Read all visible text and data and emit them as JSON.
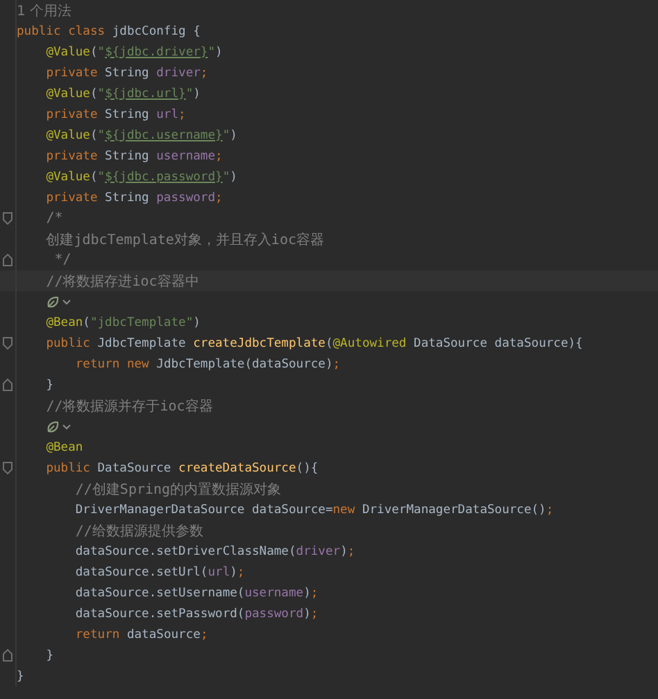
{
  "editor": {
    "lines": [
      {
        "kind": "usage_hint",
        "text": "1 个用法",
        "current": false
      },
      {
        "kind": "code",
        "current": false,
        "tokens": [
          {
            "text": "public",
            "kind": "keyword"
          },
          {
            "text": " class",
            "kind": "keyword"
          },
          {
            "text": " jdbcConfig {",
            "kind": "plain"
          }
        ],
        "children": [
          {
            "kind": "code",
            "current": false,
            "tokens": [
              {
                "text": "@Value",
                "kind": "annotation"
              },
              {
                "text": "(",
                "kind": "plain"
              },
              {
                "text": "\"",
                "kind": "string"
              },
              {
                "text": "${jdbc.driver}",
                "kind": "string_ref"
              },
              {
                "text": "\"",
                "kind": "string"
              },
              {
                "text": ")",
                "kind": "plain"
              }
            ]
          },
          {
            "kind": "code",
            "current": false,
            "tokens": [
              {
                "text": "private",
                "kind": "keyword"
              },
              {
                "text": " String ",
                "kind": "plain"
              },
              {
                "text": "driver",
                "kind": "field"
              },
              {
                "text": ";",
                "kind": "punct"
              }
            ]
          },
          {
            "kind": "code",
            "current": false,
            "tokens": [
              {
                "text": "@Value",
                "kind": "annotation"
              },
              {
                "text": "(",
                "kind": "plain"
              },
              {
                "text": "\"",
                "kind": "string"
              },
              {
                "text": "${jdbc.url}",
                "kind": "string_ref"
              },
              {
                "text": "\"",
                "kind": "string"
              },
              {
                "text": ")",
                "kind": "plain"
              }
            ]
          },
          {
            "kind": "code",
            "current": false,
            "tokens": [
              {
                "text": "private",
                "kind": "keyword"
              },
              {
                "text": " String ",
                "kind": "plain"
              },
              {
                "text": "url",
                "kind": "field"
              },
              {
                "text": ";",
                "kind": "punct"
              }
            ]
          },
          {
            "kind": "code",
            "current": false,
            "tokens": [
              {
                "text": "@Value",
                "kind": "annotation"
              },
              {
                "text": "(",
                "kind": "plain"
              },
              {
                "text": "\"",
                "kind": "string"
              },
              {
                "text": "${jdbc.username}",
                "kind": "string_ref"
              },
              {
                "text": "\"",
                "kind": "string"
              },
              {
                "text": ")",
                "kind": "plain"
              }
            ]
          },
          {
            "kind": "code",
            "current": false,
            "tokens": [
              {
                "text": "private",
                "kind": "keyword"
              },
              {
                "text": " String ",
                "kind": "plain"
              },
              {
                "text": "username",
                "kind": "field"
              },
              {
                "text": ";",
                "kind": "punct"
              }
            ]
          },
          {
            "kind": "code",
            "current": false,
            "tokens": [
              {
                "text": "@Value",
                "kind": "annotation"
              },
              {
                "text": "(",
                "kind": "plain"
              },
              {
                "text": "\"",
                "kind": "string"
              },
              {
                "text": "${jdbc.password}",
                "kind": "string_ref"
              },
              {
                "text": "\"",
                "kind": "string"
              },
              {
                "text": ")",
                "kind": "plain"
              }
            ]
          },
          {
            "kind": "code",
            "current": false,
            "tokens": [
              {
                "text": "private",
                "kind": "keyword"
              },
              {
                "text": " String ",
                "kind": "plain"
              },
              {
                "text": "password",
                "kind": "field"
              },
              {
                "text": ";",
                "kind": "punct"
              }
            ]
          },
          {
            "kind": "code",
            "current": false,
            "marker": {
              "kind": "fold_start"
            },
            "tokens": [
              {
                "text": "/*",
                "kind": "comment"
              }
            ]
          },
          {
            "kind": "code",
            "current": false,
            "tokens": [
              {
                "text": "创建jdbcTemplate对象，并且存入ioc容器",
                "kind": "comment"
              }
            ]
          },
          {
            "kind": "code",
            "current": false,
            "marker": {
              "kind": "fold_end"
            },
            "tokens": [
              {
                "text": " */",
                "kind": "comment"
              }
            ]
          },
          {
            "kind": "code",
            "current": true,
            "tokens": [
              {
                "text": "//将数据存进ioc容器中",
                "kind": "comment"
              }
            ]
          },
          {
            "kind": "bean_marker",
            "current": false
          },
          {
            "kind": "code",
            "current": false,
            "tokens": [
              {
                "text": "@Bean",
                "kind": "annotation"
              },
              {
                "text": "(",
                "kind": "plain"
              },
              {
                "text": "\"jdbcTemplate\"",
                "kind": "string"
              },
              {
                "text": ")",
                "kind": "plain"
              }
            ]
          },
          {
            "kind": "code",
            "current": false,
            "marker": {
              "kind": "fold_start"
            },
            "tokens": [
              {
                "text": "public",
                "kind": "keyword"
              },
              {
                "text": " JdbcTemplate ",
                "kind": "plain"
              },
              {
                "text": "createJdbcTemplate",
                "kind": "method"
              },
              {
                "text": "(",
                "kind": "plain"
              },
              {
                "text": "@Autowired",
                "kind": "annotation"
              },
              {
                "text": " DataSource dataSource){",
                "kind": "plain"
              }
            ],
            "children": [
              {
                "kind": "code",
                "current": false,
                "tokens": [
                  {
                    "text": "return",
                    "kind": "keyword"
                  },
                  {
                    "text": " new",
                    "kind": "keyword"
                  },
                  {
                    "text": " JdbcTemplate(dataSource)",
                    "kind": "plain"
                  },
                  {
                    "text": ";",
                    "kind": "punct"
                  }
                ]
              }
            ]
          },
          {
            "kind": "code",
            "current": false,
            "marker": {
              "kind": "fold_end"
            },
            "tokens": [
              {
                "text": "}",
                "kind": "plain"
              }
            ]
          },
          {
            "kind": "code",
            "current": false,
            "tokens": [
              {
                "text": "//将数据源并存于ioc容器",
                "kind": "comment"
              }
            ]
          },
          {
            "kind": "bean_marker",
            "current": false
          },
          {
            "kind": "code",
            "current": false,
            "tokens": [
              {
                "text": "@Bean",
                "kind": "annotation"
              }
            ]
          },
          {
            "kind": "code",
            "current": false,
            "marker": {
              "kind": "fold_start"
            },
            "tokens": [
              {
                "text": "public",
                "kind": "keyword"
              },
              {
                "text": " DataSource ",
                "kind": "plain"
              },
              {
                "text": "createDataSource",
                "kind": "method"
              },
              {
                "text": "(){",
                "kind": "plain"
              }
            ],
            "children": [
              {
                "kind": "code",
                "current": false,
                "tokens": [
                  {
                    "text": "//创建Spring的内置数据源对象",
                    "kind": "comment"
                  }
                ]
              },
              {
                "kind": "code",
                "current": false,
                "tokens": [
                  {
                    "text": "DriverManagerDataSource dataSource=",
                    "kind": "plain"
                  },
                  {
                    "text": "new",
                    "kind": "keyword"
                  },
                  {
                    "text": " DriverManagerDataSource()",
                    "kind": "plain"
                  },
                  {
                    "text": ";",
                    "kind": "punct"
                  }
                ]
              },
              {
                "kind": "code",
                "current": false,
                "tokens": [
                  {
                    "text": "//给数据源提供参数",
                    "kind": "comment"
                  }
                ]
              },
              {
                "kind": "code",
                "current": false,
                "tokens": [
                  {
                    "text": "dataSource.setDriverClassName(",
                    "kind": "plain"
                  },
                  {
                    "text": "driver",
                    "kind": "field"
                  },
                  {
                    "text": ")",
                    "kind": "plain"
                  },
                  {
                    "text": ";",
                    "kind": "punct"
                  }
                ]
              },
              {
                "kind": "code",
                "current": false,
                "tokens": [
                  {
                    "text": "dataSource.setUrl(",
                    "kind": "plain"
                  },
                  {
                    "text": "url",
                    "kind": "field"
                  },
                  {
                    "text": ")",
                    "kind": "plain"
                  },
                  {
                    "text": ";",
                    "kind": "punct"
                  }
                ]
              },
              {
                "kind": "code",
                "current": false,
                "tokens": [
                  {
                    "text": "dataSource.setUsername(",
                    "kind": "plain"
                  },
                  {
                    "text": "username",
                    "kind": "field"
                  },
                  {
                    "text": ")",
                    "kind": "plain"
                  },
                  {
                    "text": ";",
                    "kind": "punct"
                  }
                ]
              },
              {
                "kind": "code",
                "current": false,
                "tokens": [
                  {
                    "text": "dataSource.setPassword(",
                    "kind": "plain"
                  },
                  {
                    "text": "password",
                    "kind": "field"
                  },
                  {
                    "text": ")",
                    "kind": "plain"
                  },
                  {
                    "text": ";",
                    "kind": "punct"
                  }
                ]
              },
              {
                "kind": "code",
                "current": false,
                "tokens": [
                  {
                    "text": "return",
                    "kind": "keyword"
                  },
                  {
                    "text": " dataSource",
                    "kind": "plain"
                  },
                  {
                    "text": ";",
                    "kind": "punct"
                  }
                ]
              }
            ]
          },
          {
            "kind": "code",
            "current": false,
            "marker": {
              "kind": "fold_end"
            },
            "tokens": [
              {
                "text": "}",
                "kind": "plain"
              }
            ]
          }
        ]
      },
      {
        "kind": "code",
        "current": false,
        "tokens": [
          {
            "text": "}",
            "kind": "plain"
          }
        ]
      }
    ]
  }
}
